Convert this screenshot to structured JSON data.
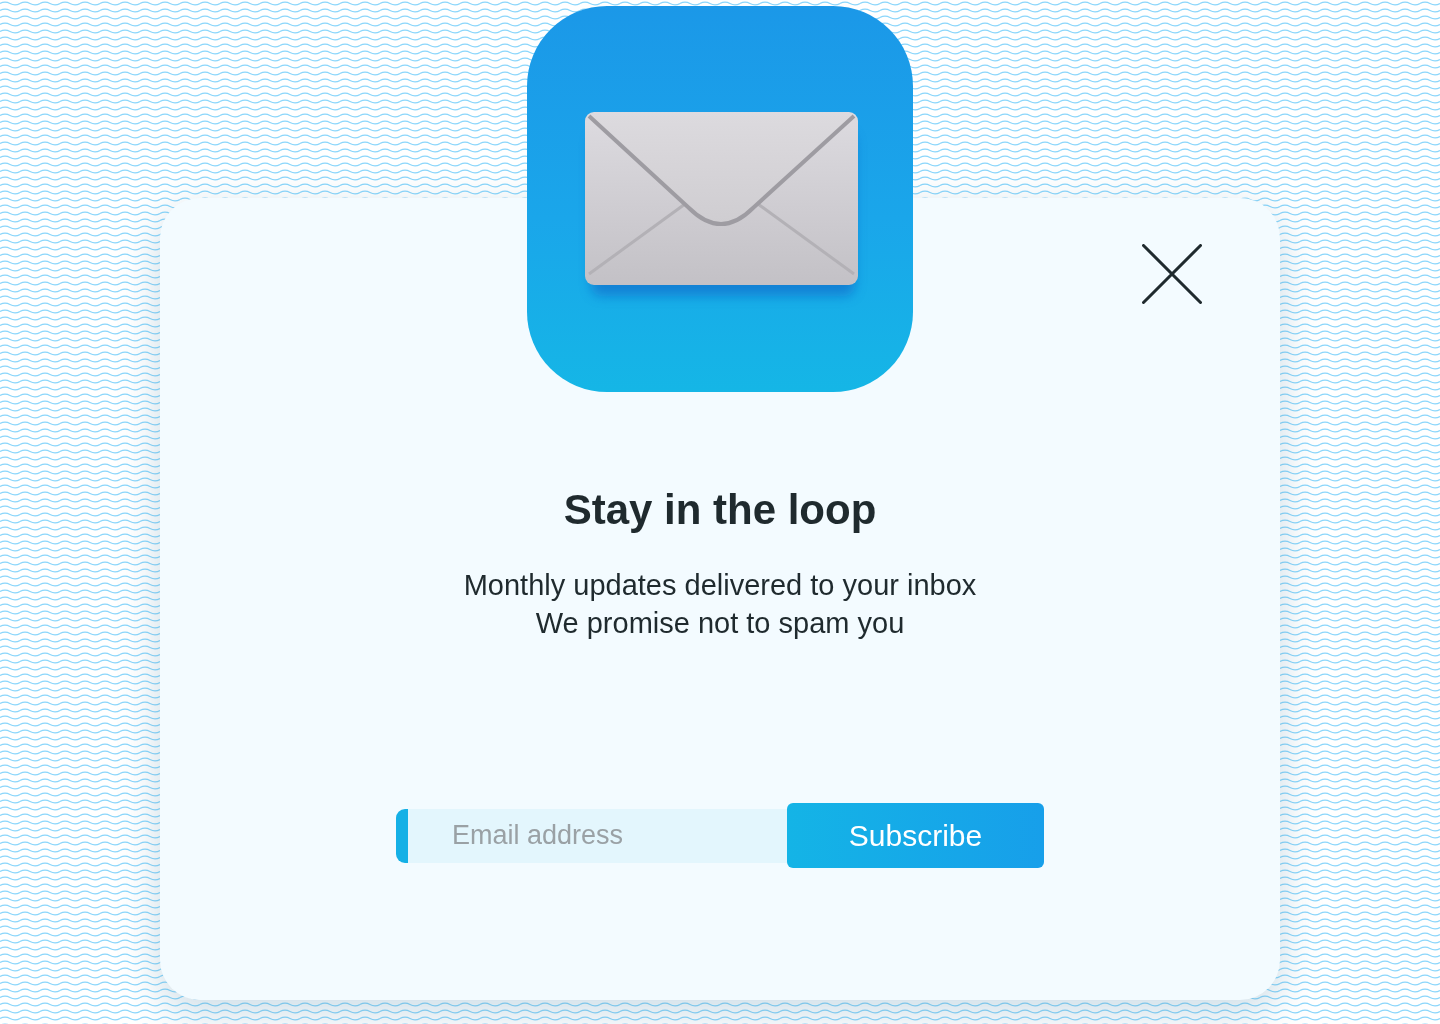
{
  "dialog": {
    "title": "Stay in the loop",
    "description_lines": [
      "Monthly updates delivered to your inbox",
      "We promise not to spam you"
    ],
    "email_field": {
      "placeholder": "Email address"
    },
    "subscribe_button": {
      "label": "Subscribe"
    }
  }
}
